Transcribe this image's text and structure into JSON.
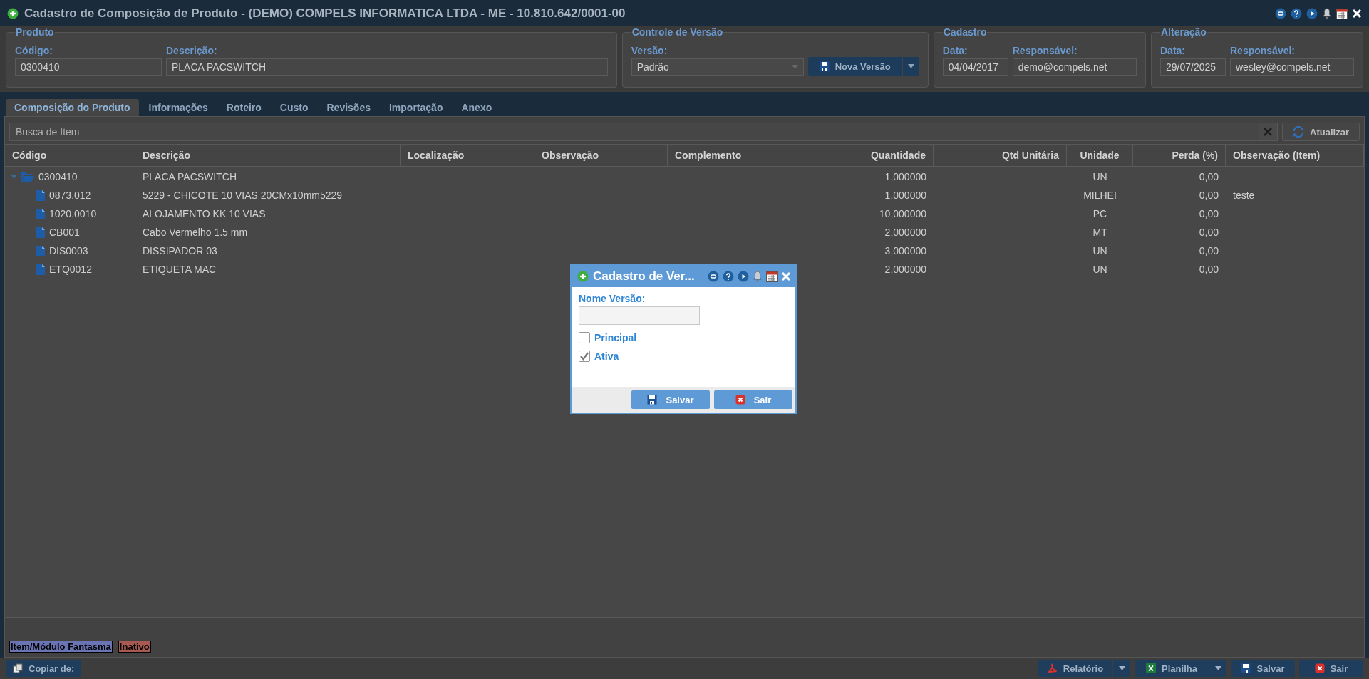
{
  "window": {
    "title": "Cadastro de Composição de Produto - (DEMO) COMPELS INFORMATICA LTDA - ME - 10.810.642/0001-00"
  },
  "panels": [
    {
      "legend": "Produto",
      "fields": [
        {
          "label": "Código:",
          "value": "0300410",
          "kind": "input"
        },
        {
          "label": "Descrição:",
          "value": "PLACA PACSWITCH",
          "kind": "input"
        }
      ]
    },
    {
      "legend": "Controle de Versão",
      "fields": [
        {
          "label": "Versão:",
          "value": "Padrão",
          "kind": "select"
        }
      ],
      "action": "Nova Versão"
    },
    {
      "legend": "Cadastro",
      "fields": [
        {
          "label": "Data:",
          "value": "04/04/2017",
          "kind": "input"
        },
        {
          "label": "Responsável:",
          "value": "demo@compels.net",
          "kind": "input"
        }
      ]
    },
    {
      "legend": "Alteração",
      "fields": [
        {
          "label": "Data:",
          "value": "29/07/2025",
          "kind": "input"
        },
        {
          "label": "Responsável:",
          "value": "wesley@compels.net",
          "kind": "input"
        }
      ]
    }
  ],
  "tabs": [
    {
      "label": "Composição do Produto",
      "selected": true
    },
    {
      "label": "Informações",
      "selected": false
    },
    {
      "label": "Roteiro",
      "selected": false
    },
    {
      "label": "Custo",
      "selected": false
    },
    {
      "label": "Revisões",
      "selected": false
    },
    {
      "label": "Importação",
      "selected": false
    },
    {
      "label": "Anexo",
      "selected": false
    }
  ],
  "search": {
    "placeholder": "Busca de Item"
  },
  "refresh_button": "Atualizar",
  "table": {
    "columns": [
      "Código",
      "Descrição",
      "Localização",
      "Observação",
      "Complemento",
      "Quantidade",
      "Qtd Unitária",
      "Unidade",
      "Perda (%)",
      "Observação (Item)"
    ],
    "rows": [
      {
        "code": "0300410",
        "description": "PLACA PACSWITCH",
        "quantity": "1,000000",
        "unit": "UN",
        "loss": "0,00",
        "expanded": true,
        "children": [
          {
            "code": "0873.012",
            "description": "5229 - CHICOTE 10 VIAS 20CMx10mm5229",
            "quantity": "1,000000",
            "unit": "MILHEI",
            "loss": "0,00",
            "item_note": "teste"
          },
          {
            "code": "1020.0010",
            "description": "ALOJAMENTO KK 10 VIAS",
            "quantity": "10,000000",
            "unit": "PC",
            "loss": "0,00"
          },
          {
            "code": "CB001",
            "description": "Cabo Vermelho 1.5 mm",
            "quantity": "2,000000",
            "unit": "MT",
            "loss": "0,00"
          },
          {
            "code": "DIS0003",
            "description": "DISSIPADOR 03",
            "quantity": "3,000000",
            "unit": "UN",
            "loss": "0,00"
          },
          {
            "code": "ETQ0012",
            "description": "ETIQUETA MAC",
            "quantity": "2,000000",
            "unit": "UN",
            "loss": "0,00"
          }
        ]
      }
    ]
  },
  "legend": [
    {
      "label": "Item/Módulo Fantasma",
      "color": "#6a74b4"
    },
    {
      "label": "Inativo",
      "color": "#a85a52"
    }
  ],
  "footer": {
    "copy_button": "Copiar de:",
    "buttons": [
      {
        "label": "Relatório",
        "kind": "split"
      },
      {
        "label": "Planilha",
        "kind": "split"
      },
      {
        "label": "Salvar",
        "kind": "plain"
      },
      {
        "label": "Sair",
        "kind": "plain"
      }
    ]
  },
  "dialog": {
    "title": "Cadastro de Ver...",
    "field_label": "Nome Versão:",
    "checkboxes": [
      {
        "label": "Principal",
        "checked": false
      },
      {
        "label": "Ativa",
        "checked": true
      }
    ],
    "buttons": [
      "Salvar",
      "Sair"
    ]
  }
}
